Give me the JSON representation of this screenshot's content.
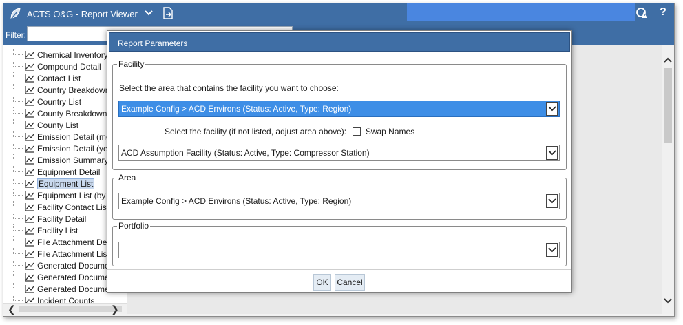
{
  "app": {
    "title": "ACTS O&G - Report Viewer"
  },
  "filter": {
    "label": "Filter:",
    "value": ""
  },
  "tree": {
    "items": [
      {
        "label": "Chemical Inventory",
        "selected": false
      },
      {
        "label": "Compound Detail",
        "selected": false
      },
      {
        "label": "Contact List",
        "selected": false
      },
      {
        "label": "Country Breakdown",
        "selected": false
      },
      {
        "label": "Country List",
        "selected": false
      },
      {
        "label": "County Breakdown",
        "selected": false
      },
      {
        "label": "County List",
        "selected": false
      },
      {
        "label": "Emission Detail (mor",
        "selected": false
      },
      {
        "label": "Emission Detail (year",
        "selected": false
      },
      {
        "label": "Emission Summary",
        "selected": false
      },
      {
        "label": "Equipment Detail",
        "selected": false
      },
      {
        "label": "Equipment List",
        "selected": true
      },
      {
        "label": "Equipment List (by t",
        "selected": false
      },
      {
        "label": "Facility Contact List",
        "selected": false
      },
      {
        "label": "Facility Detail",
        "selected": false
      },
      {
        "label": "Facility List",
        "selected": false
      },
      {
        "label": "File Attachment Deta",
        "selected": false
      },
      {
        "label": "File Attachment List",
        "selected": false
      },
      {
        "label": "Generated Documer",
        "selected": false
      },
      {
        "label": "Generated Documer",
        "selected": false
      },
      {
        "label": "Generated Documer",
        "selected": false
      },
      {
        "label": "Incident Counts",
        "selected": false
      }
    ]
  },
  "dialog": {
    "title": "Report Parameters",
    "facility": {
      "legend": "Facility",
      "area_prompt": "Select the area that contains the facility you want to choose:",
      "area_value": "Example Config > ACD Environs (Status: Active, Type: Region)",
      "facility_prompt": "Select the facility (if not listed, adjust area above):",
      "swap_label": "Swap Names",
      "swap_checked": false,
      "facility_value": "ACD Assumption Facility (Status: Active, Type: Compressor Station)"
    },
    "area": {
      "legend": "Area",
      "value": "Example Config > ACD Environs (Status: Active, Type: Region)"
    },
    "portfolio": {
      "legend": "Portfolio",
      "value": ""
    },
    "ok_label": "OK",
    "cancel_label": "Cancel"
  },
  "icons": {
    "logo": "leaf-icon",
    "dropdown": "chevron-down-icon",
    "export": "document-export-icon",
    "account": "user-alert-icon",
    "help": "help-icon",
    "report": "line-chart-icon"
  },
  "colors": {
    "header": "#3f6ea5",
    "search": "#4a86e0",
    "selection": "#3e8ee6",
    "tree_selection": "#c9d9ee"
  }
}
